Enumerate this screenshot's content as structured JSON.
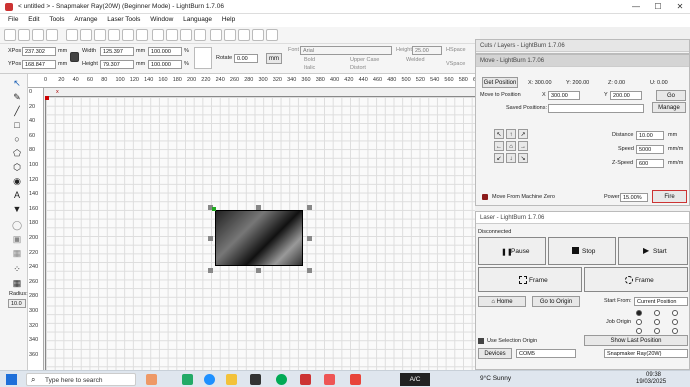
{
  "window": {
    "title": "< untitled > - Snapmaker Ray(20W) (Beginner Mode) - LightBurn 1.7.06",
    "min": "—",
    "max": "☐",
    "close": "✕"
  },
  "menu": [
    "File",
    "Edit",
    "Tools",
    "Arrange",
    "Laser Tools",
    "Window",
    "Language",
    "Help"
  ],
  "props": {
    "xpos_label": "XPos",
    "xpos": "237.302",
    "ypos_label": "YPos",
    "ypos": "168.847",
    "unit": "mm",
    "width_label": "Width",
    "width": "125.397",
    "height_label": "Height",
    "height": "79.307",
    "wpct": "100.000",
    "hpct": "100.000",
    "pct": "%",
    "rotate_label": "Rotate",
    "rotate": "0.00",
    "mm_btn": "mm",
    "font_label": "Font",
    "font": "Arial",
    "fheight_label": "Height",
    "fheight": "25.00",
    "hspace_label": "HSpace",
    "hspace": "0.00",
    "bold": "Bold",
    "italic": "Italic",
    "upper": "Upper Case",
    "distort": "Distort",
    "welded": "Welded",
    "vspace_label": "VSpace",
    "vspace": "0.00"
  },
  "ruler_top": [
    "0",
    "20",
    "40",
    "60",
    "80",
    "100",
    "120",
    "140",
    "160",
    "180",
    "200",
    "220",
    "240",
    "260",
    "280",
    "300",
    "320",
    "340",
    "360",
    "380",
    "400",
    "420",
    "440",
    "460",
    "480",
    "500",
    "520",
    "540",
    "560",
    "580",
    "600"
  ],
  "ruler_left": [
    "0",
    "20",
    "40",
    "60",
    "80",
    "100",
    "120",
    "140",
    "160",
    "180",
    "200",
    "220",
    "240",
    "260",
    "280",
    "300",
    "320",
    "340",
    "360"
  ],
  "left_tools": {
    "radius_label": "Radius:",
    "radius": "10.0"
  },
  "cuts": {
    "title": "Cuts / Layers - LightBurn 1.7.06"
  },
  "move": {
    "title": "Move - LightBurn 1.7.06",
    "get_position": "Get Position",
    "x_lbl": "X: 300.00",
    "y_lbl": "Y: 200.00",
    "z_lbl": "Z: 0.00",
    "u_lbl": "U: 0.00",
    "move_to": "Move to Position",
    "x_field_label": "X",
    "x_field": "300.00",
    "y_field_label": "Y",
    "y_field": "200.00",
    "go": "Go",
    "saved_label": "Saved Positions:",
    "manage": "Manage",
    "distance_label": "Distance",
    "distance": "10.00",
    "speed_label": "Speed",
    "speed": "5000",
    "zspeed_label": "Z-Speed",
    "zspeed": "600",
    "unit_mm": "mm",
    "unit_mms": "mm/m",
    "move_from_zero": "Move From Machine Zero",
    "power_label": "Power",
    "power": "15.00%",
    "fire": "Fire"
  },
  "laser": {
    "title": "Laser - LightBurn 1.7.06",
    "status": "Disconnected",
    "pause": "Pause",
    "stop": "Stop",
    "start": "Start",
    "frame1": "Frame",
    "frame2": "Frame",
    "home": "Home",
    "go_origin": "Go to Origin",
    "start_from_label": "Start From:",
    "start_from": "Current Position",
    "job_origin_label": "Job Origin",
    "use_selection": "Use Selection Origin",
    "show_last": "Show Last Position",
    "devices": "Devices",
    "port": "COM5",
    "device": "Snapmaker Ray(20W)"
  },
  "taskbar": {
    "search": "Type here to search",
    "app": "A/C",
    "weather": "9°C  Sunny",
    "time": "09:38",
    "date": "19/03/2025"
  }
}
